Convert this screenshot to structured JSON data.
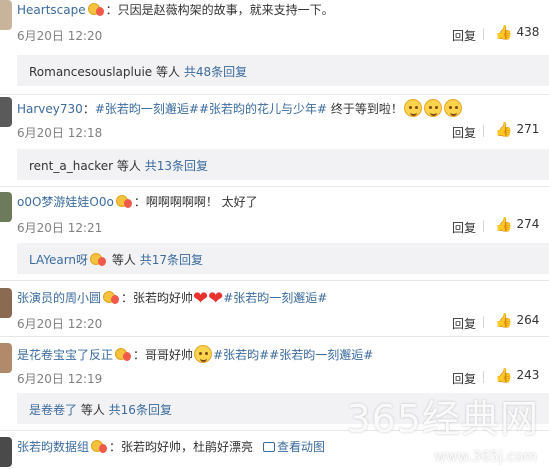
{
  "comments": [
    {
      "username": "Heartscape",
      "text": "：只因是赵薇构架的故事，就来支持一下。",
      "date": "6月20日 12:20",
      "reply_label": "回复",
      "likes": "438",
      "replies_text": "Romancesouslapluie 等人",
      "replies_count": "共48条回复",
      "avatar_color": "#c8b49a"
    },
    {
      "username": "Harvey730",
      "text_prefix": "：",
      "hashtag1": "#张若昀一刻邂逅#",
      "hashtag2": "#张若昀的花儿与少年#",
      "text_suffix": " 终于等到啦！",
      "date": "6月20日 12:18",
      "reply_label": "回复",
      "likes": "271",
      "replies_text": "rent_a_hacker 等人",
      "replies_count": "共13条回复",
      "avatar_color": "#5a5a5a"
    },
    {
      "username": "o0O梦游娃娃O0o",
      "text": "：啊啊啊啊啊！ 太好了",
      "date": "6月20日 12:21",
      "reply_label": "回复",
      "likes": "274",
      "replies_text": "LAYearn呀",
      "replies_suffix": " 等人",
      "replies_count": "共17条回复",
      "avatar_color": "#6e7a5c"
    },
    {
      "username": "张演员的周小圆",
      "text": "：张若昀好帅",
      "hashtag1": "#张若昀一刻邂逅#",
      "date": "6月20日 12:20",
      "reply_label": "回复",
      "likes": "264",
      "avatar_color": "#8a6a50"
    },
    {
      "username": "是花卷宝宝了反正",
      "text": "：哥哥好帅",
      "hashtag1": "#张若昀#",
      "hashtag2": "#张若昀一刻邂逅#",
      "date": "6月20日 12:19",
      "reply_label": "回复",
      "likes": "243",
      "replies_text": "是卷卷了",
      "replies_suffix": " 等人",
      "replies_count": "共16条回复",
      "avatar_color": "#b08a6a"
    },
    {
      "username": "张若昀数据组",
      "text": "：张若昀好帅，杜鹃好漂亮",
      "link": "查看动图",
      "avatar_color": "#4a4a4a"
    }
  ],
  "watermark": {
    "text": "365经典网",
    "url": "www.365j.com"
  },
  "colors": {
    "link": "#3c6b9e",
    "subbox_bg": "#f2f2f5"
  },
  "icons": {
    "like": "thumbs-up-icon",
    "badge": "vip-badge-icon"
  }
}
